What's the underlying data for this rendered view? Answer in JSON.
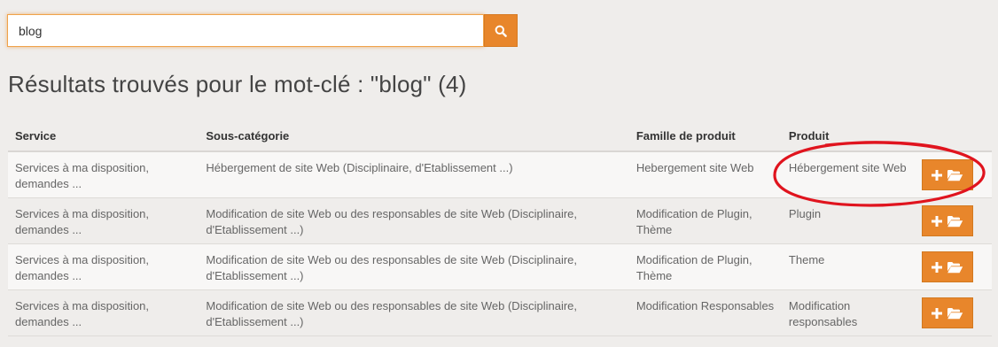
{
  "search": {
    "value": "blog",
    "button_icon": "search-icon"
  },
  "results_heading": "Résultats trouvés pour le mot-clé : \"blog\" (4)",
  "table": {
    "headers": [
      "Service",
      "Sous-catégorie",
      "Famille de produit",
      "Produit"
    ],
    "rows": [
      {
        "service": "Services à ma disposition, demandes ...",
        "subcategory": "Hébergement de site Web (Disciplinaire, d'Etablissement ...)",
        "family": "Hebergement site Web",
        "product": "Hébergement site Web"
      },
      {
        "service": "Services à ma disposition, demandes ...",
        "subcategory": "Modification de site Web ou des responsables de site Web (Disciplinaire, d'Etablissement ...)",
        "family": "Modification de Plugin, Thème",
        "product": "Plugin"
      },
      {
        "service": "Services à ma disposition, demandes ...",
        "subcategory": "Modification de site Web ou des responsables de site Web (Disciplinaire, d'Etablissement ...)",
        "family": "Modification de Plugin, Thème",
        "product": "Theme"
      },
      {
        "service": "Services à ma disposition, demandes ...",
        "subcategory": "Modification de site Web ou des responsables de site Web (Disciplinaire, d'Etablissement ...)",
        "family": "Modification Responsables",
        "product": "Modification responsables"
      }
    ],
    "row_action_icons": [
      "plus-icon",
      "folder-open-icon"
    ]
  },
  "colors": {
    "accent": "#e8862b",
    "annotation": "#e0141e",
    "background": "#efedeb"
  }
}
